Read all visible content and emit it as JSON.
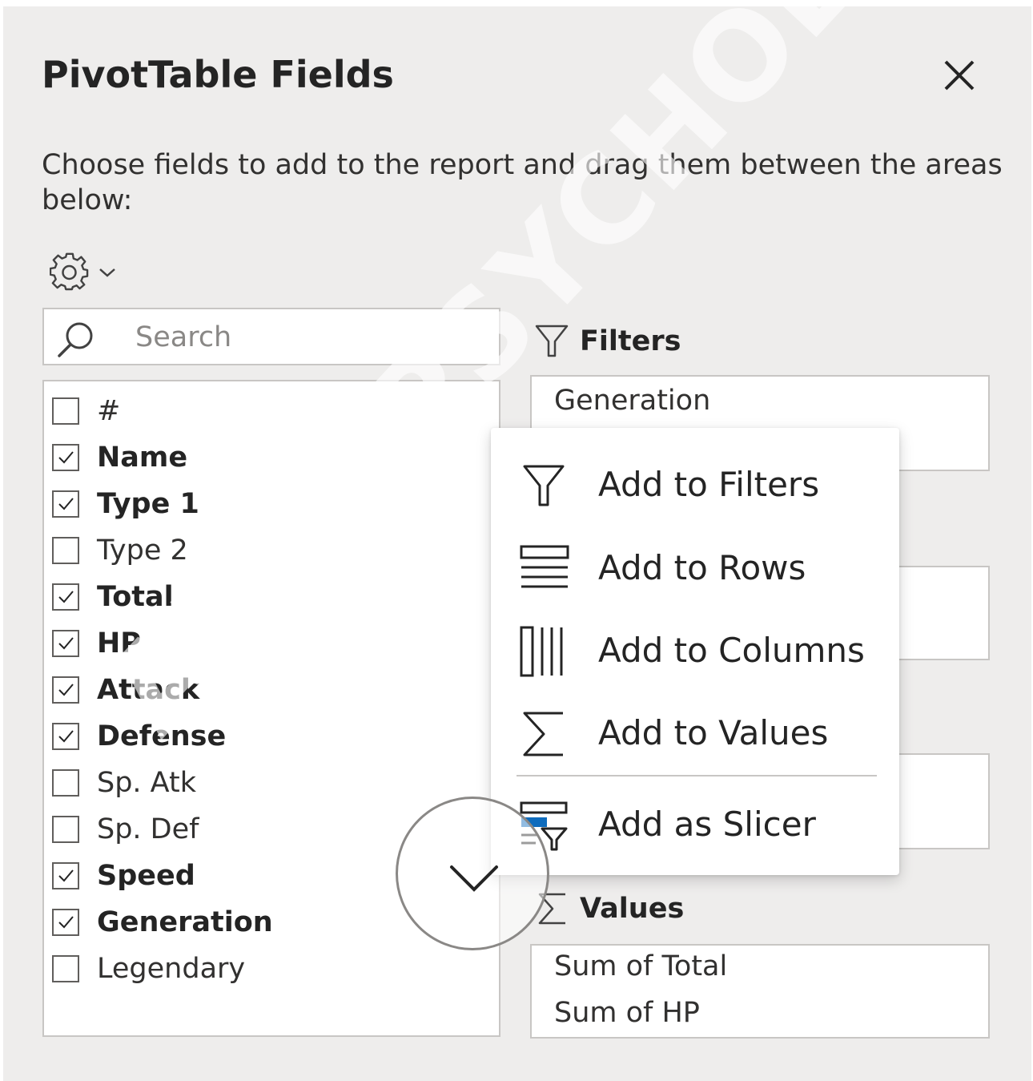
{
  "header": {
    "title": "PivotTable Fields",
    "description": "Choose fields to add to the report and drag them between the areas below:"
  },
  "search": {
    "placeholder": "Search"
  },
  "fields": [
    {
      "label": "#",
      "checked": false
    },
    {
      "label": "Name",
      "checked": true
    },
    {
      "label": "Type 1",
      "checked": true
    },
    {
      "label": "Type 2",
      "checked": false
    },
    {
      "label": "Total",
      "checked": true
    },
    {
      "label": "HP",
      "checked": true
    },
    {
      "label": "Attack",
      "checked": true
    },
    {
      "label": "Defense",
      "checked": true
    },
    {
      "label": "Sp. Atk",
      "checked": false
    },
    {
      "label": "Sp. Def",
      "checked": false
    },
    {
      "label": "Speed",
      "checked": true
    },
    {
      "label": "Generation",
      "checked": true
    },
    {
      "label": "Legendary",
      "checked": false
    }
  ],
  "areas": {
    "filters": {
      "label": "Filters",
      "items": [
        "Generation"
      ]
    },
    "values": {
      "label": "Values",
      "items": [
        "Sum of Total",
        "Sum of HP"
      ]
    }
  },
  "context_menu": {
    "items": [
      {
        "label": "Add to Filters",
        "icon": "filter-icon"
      },
      {
        "label": "Add to Rows",
        "icon": "rows-icon"
      },
      {
        "label": "Add to Columns",
        "icon": "columns-icon"
      },
      {
        "label": "Add to Values",
        "icon": "sigma-icon"
      },
      {
        "label": "Add as Slicer",
        "icon": "slicer-icon"
      }
    ]
  },
  "watermark": "ARABPSYCHOLOGY.COM",
  "colors": {
    "pane_bg": "#eeedec",
    "border": "#c8c6c4",
    "text": "#242424",
    "accent_blue": "#0f6cbd"
  }
}
